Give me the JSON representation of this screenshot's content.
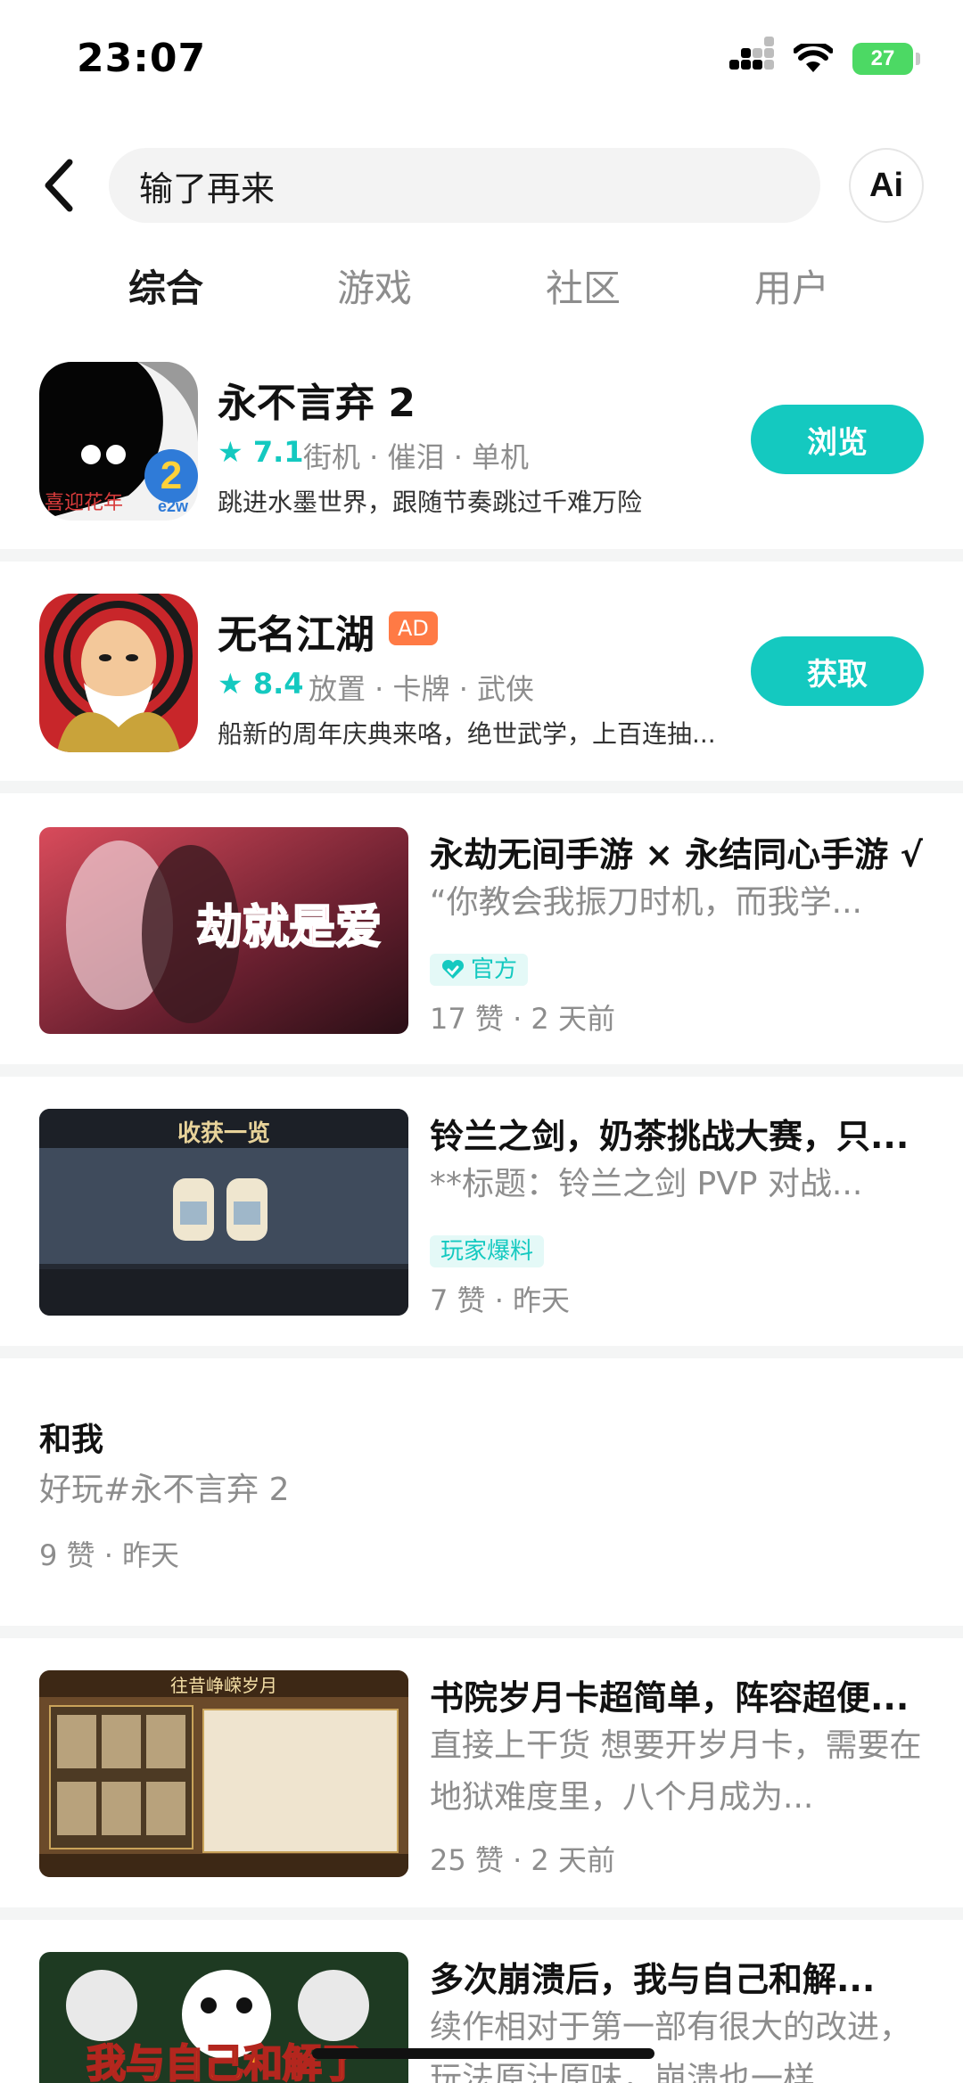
{
  "status_bar": {
    "time": "23:07",
    "battery": "27"
  },
  "search": {
    "query": "输了再来",
    "ai_label": "Ai"
  },
  "tabs": [
    "综合",
    "游戏",
    "社区",
    "用户"
  ],
  "apps": [
    {
      "title": "永不言弃 2",
      "rating": "7.1",
      "tags": "街机 · 催泪 · 单机",
      "description": "跳进水墨世界，跟随节奏跳过千难万险",
      "button": "浏览",
      "icon_text": [
        "喜迎花年",
        "2",
        "e2w"
      ]
    },
    {
      "title": "无名江湖",
      "ad": "AD",
      "rating": "8.4",
      "tags": "放置 · 卡牌 · 武侠",
      "description": "船新的周年庆典来咯，绝世武学，上百连抽...",
      "button": "获取"
    }
  ],
  "posts": [
    {
      "title": "永劫无间手游 × 永结同心手游 √",
      "excerpt": "“你教会我振刀时机，而我学...",
      "badge": "官方",
      "meta": "17 赞 · 2 天前",
      "thumb_text": "劫就是爱"
    },
    {
      "title": "铃兰之剑，奶茶挑战大赛，只...",
      "excerpt": "**标题：铃兰之剑 PVP 对战...",
      "badge": "玩家爆料",
      "meta": "7 赞 · 昨天",
      "thumb_text": "收获一览"
    },
    {
      "title": "和我",
      "excerpt": "好玩#永不言弃 2",
      "meta": "9 赞 · 昨天"
    },
    {
      "title": "书院岁月卡超简单，阵容超便...",
      "excerpt": "直接上干货 想要开岁月卡，需要在地狱难度里，八个月成为...",
      "meta": "25 赞 · 2 天前",
      "thumb_text": "往昔峥嵘岁月"
    },
    {
      "title": "多次崩溃后，我与自己和解...",
      "excerpt": "续作相对于第一部有很大的改进，玩法原汁原味，崩溃也一样",
      "thumb_text": "我与自己和解了"
    }
  ],
  "colors": {
    "accent": "#14c9c0",
    "ad": "#ff7a45",
    "divider": "#f4f5f5"
  }
}
